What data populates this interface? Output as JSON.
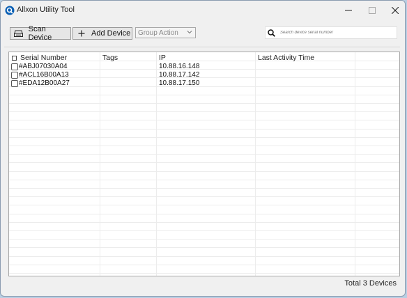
{
  "window": {
    "title": "Allxon Utility Tool",
    "controls": {
      "minimize": "—",
      "maximize": "☐",
      "close": "✕"
    }
  },
  "toolbar": {
    "scan_label": "Scan Device",
    "add_label": "Add Device",
    "group_action": "Group Action",
    "search_placeholder": "Search device serial number"
  },
  "table": {
    "columns": [
      "Serial Number",
      "Tags",
      "IP",
      "Last Activity Time"
    ],
    "rows": [
      {
        "serial": "#ABJ07030A04",
        "tags": "",
        "ip": "10.88.16.148",
        "last_activity": ""
      },
      {
        "serial": "#ACL16B00A13",
        "tags": "",
        "ip": "10.88.17.142",
        "last_activity": ""
      },
      {
        "serial": "#EDA12B00A27",
        "tags": "",
        "ip": "10.88.17.150",
        "last_activity": ""
      }
    ]
  },
  "status": {
    "total": "Total 3 Devices"
  },
  "colors": {
    "accent": "#0a5fb4",
    "window_bg": "#f0f0f0",
    "grid_bg": "#ffffff"
  }
}
